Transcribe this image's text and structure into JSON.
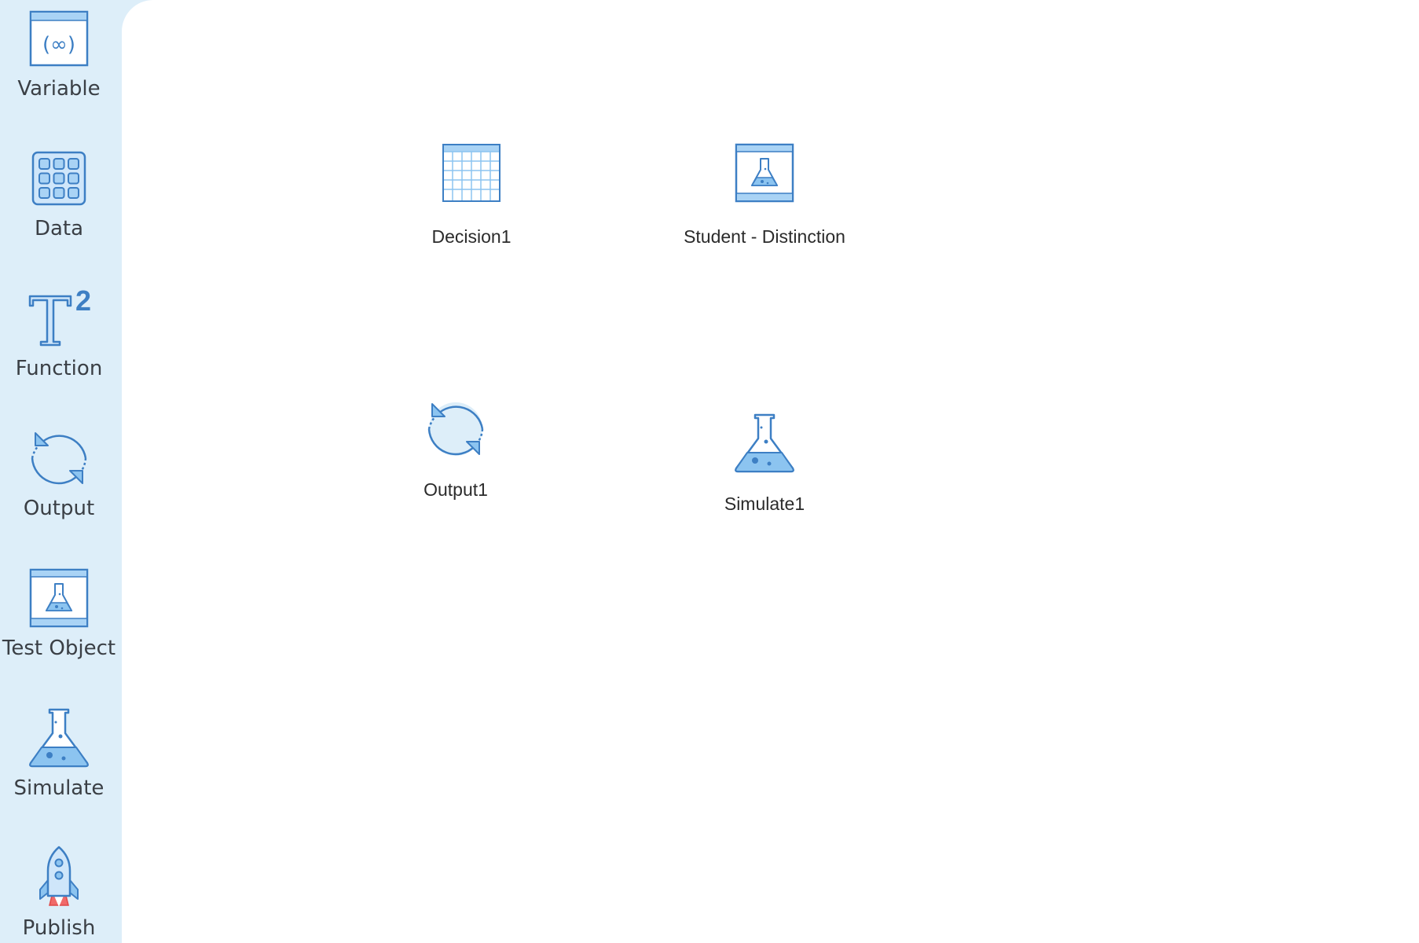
{
  "palette": {
    "items": [
      {
        "label": "Variable",
        "icon": "variable-icon"
      },
      {
        "label": "Data",
        "icon": "data-grid-icon"
      },
      {
        "label": "Function",
        "icon": "function-icon"
      },
      {
        "label": "Output",
        "icon": "output-cycle-icon"
      },
      {
        "label": "Test Object",
        "icon": "test-object-icon"
      },
      {
        "label": "Simulate",
        "icon": "flask-icon"
      },
      {
        "label": "Publish",
        "icon": "rocket-icon"
      }
    ],
    "function_superscript": "2",
    "variable_glyph": "(∞)"
  },
  "canvas": {
    "nodes": [
      {
        "label": "Decision1",
        "icon": "decision-table-icon"
      },
      {
        "label": "Student - Distinction",
        "icon": "test-object-icon"
      },
      {
        "label": "Output1",
        "icon": "output-cycle-icon"
      },
      {
        "label": "Simulate1",
        "icon": "flask-icon"
      }
    ]
  },
  "colors": {
    "palette_bg": "#ddeef9",
    "icon_stroke": "#3d7fc4",
    "icon_fill_light": "#cfe6fa",
    "icon_fill_mid": "#8cc4f0",
    "rocket_flame": "#f06a6a"
  }
}
